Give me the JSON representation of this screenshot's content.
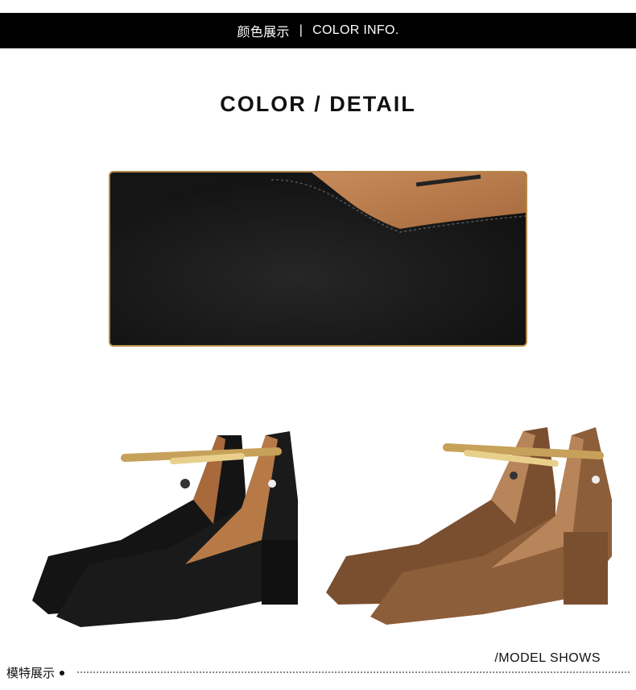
{
  "banner": {
    "title_cn": "颜色展示",
    "separator": "|",
    "title_en": "COLOR INFO."
  },
  "heading": {
    "text": "COLOR / DETAIL"
  },
  "detail_image": {
    "icon": "suede-closeup-image"
  },
  "products": [
    {
      "icon": "black-suede-pump-image",
      "color": "#1a1a1a"
    },
    {
      "icon": "brown-suede-pump-image",
      "color": "#8a5a35"
    }
  ],
  "footer": {
    "left_label": "模特展示",
    "right_label": "/MODEL SHOWS"
  }
}
